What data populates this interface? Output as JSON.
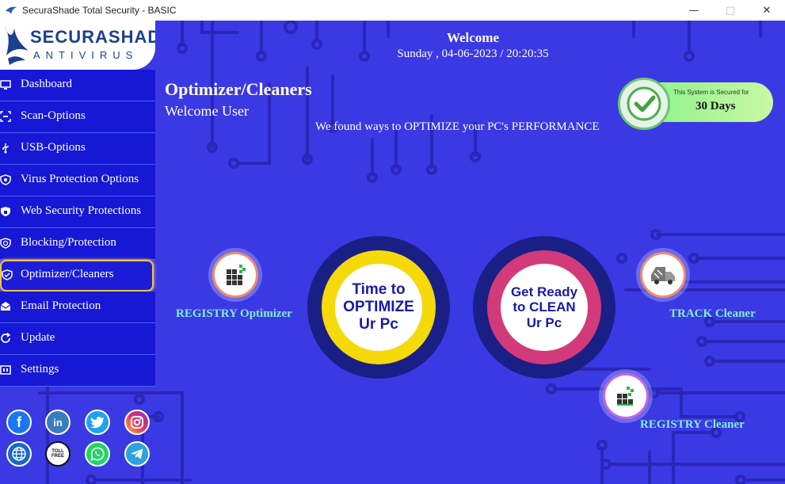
{
  "window": {
    "title": "SecuraShade Total Security - BASIC"
  },
  "logo": {
    "name": "SECURASHADE",
    "sub": "ANTIVIRUS"
  },
  "header": {
    "welcome": "Welcome",
    "datetime": "Sunday , 04-06-2023 / 20:20:35"
  },
  "sidebar": {
    "items": [
      {
        "label": "Dashboard",
        "icon": "monitor-icon"
      },
      {
        "label": "Scan-Options",
        "icon": "scan-icon"
      },
      {
        "label": "USB-Options",
        "icon": "usb-icon"
      },
      {
        "label": "Virus Protection Options",
        "icon": "virus-shield-icon"
      },
      {
        "label": "Web Security Protections",
        "icon": "web-shield-icon"
      },
      {
        "label": "Blocking/Protection",
        "icon": "block-icon"
      },
      {
        "label": "Optimizer/Cleaners",
        "icon": "optimizer-icon",
        "active": true
      },
      {
        "label": "Email Protection",
        "icon": "email-icon"
      },
      {
        "label": "Update",
        "icon": "update-icon"
      },
      {
        "label": "Settings",
        "icon": "settings-icon"
      }
    ]
  },
  "social": {
    "facebook": "f",
    "linkedin": "in",
    "tollfree": "TOLL FREE"
  },
  "main": {
    "title": "Optimizer/Cleaners",
    "subtitle": "Welcome User",
    "tagline": "We found ways to OPTIMIZE your PC's PERFORMANCE"
  },
  "badge": {
    "text": "This System is Secured for",
    "days": "30 Days"
  },
  "tools": {
    "registry_optimizer": "REGISTRY Optimizer",
    "track_cleaner": "TRACK Cleaner",
    "registry_cleaner": "REGISTRY Cleaner"
  },
  "buttons": {
    "optimize": {
      "line1": "Time to",
      "line2": "OPTIMIZE",
      "line3": "Ur Pc"
    },
    "clean": {
      "line1": "Get Ready",
      "line2": "to CLEAN",
      "line3": "Ur Pc"
    }
  },
  "colors": {
    "background": "#3b39e4",
    "sidebar": "#1717d6",
    "active_border": "#f0c24a",
    "optimize_ring": "#f5d90a",
    "clean_ring": "#d23a7a",
    "tool_label": "#7ff0d8"
  }
}
